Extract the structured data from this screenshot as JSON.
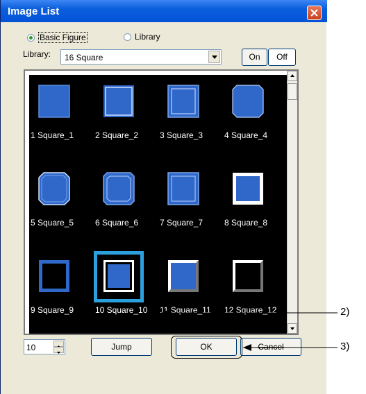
{
  "dialog": {
    "title": "Image List",
    "radio_basic_figure": "Basic Figure",
    "radio_library": "Library",
    "library_label": "Library:",
    "library_value": "16 Square",
    "on_label": "On",
    "off_label": "Off",
    "jump_value": "10",
    "jump_label": "Jump",
    "ok_label": "OK",
    "cancel_label": "Cancel"
  },
  "images": [
    {
      "label": "1 Square_1"
    },
    {
      "label": "2 Square_2"
    },
    {
      "label": "3 Square_3"
    },
    {
      "label": "4 Square_4"
    },
    {
      "label": "5 Square_5"
    },
    {
      "label": "6 Square_6"
    },
    {
      "label": "7 Square_7"
    },
    {
      "label": "8 Square_8"
    },
    {
      "label": "9 Square_9"
    },
    {
      "label": "10 Square_10"
    },
    {
      "label": "11 Square_11"
    },
    {
      "label": "12 Square_12"
    }
  ],
  "annotations": {
    "callout_2": "2)",
    "callout_3": "3)"
  }
}
